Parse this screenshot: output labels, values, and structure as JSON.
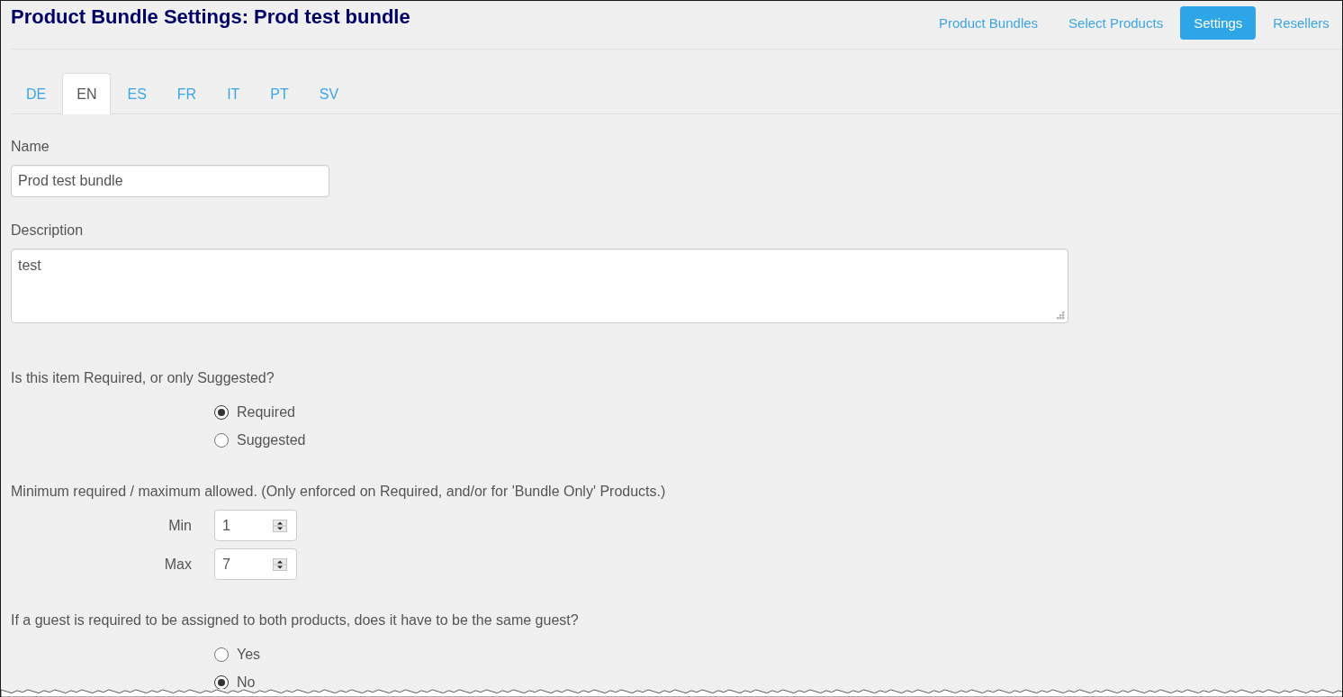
{
  "header": {
    "title": "Product Bundle Settings: Prod test bundle",
    "nav": [
      {
        "label": "Product Bundles",
        "selected": false
      },
      {
        "label": "Select Products",
        "selected": false
      },
      {
        "label": "Settings",
        "selected": true
      },
      {
        "label": "Resellers",
        "selected": false
      }
    ]
  },
  "language_tabs": [
    {
      "label": "DE",
      "selected": false
    },
    {
      "label": "EN",
      "selected": true
    },
    {
      "label": "ES",
      "selected": false
    },
    {
      "label": "FR",
      "selected": false
    },
    {
      "label": "IT",
      "selected": false
    },
    {
      "label": "PT",
      "selected": false
    },
    {
      "label": "SV",
      "selected": false
    }
  ],
  "form": {
    "name": {
      "label": "Name",
      "value": "Prod test bundle"
    },
    "description": {
      "label": "Description",
      "value": "test"
    },
    "requirement": {
      "question": "Is this item Required, or only Suggested?",
      "options": [
        {
          "label": "Required",
          "selected": true
        },
        {
          "label": "Suggested",
          "selected": false
        }
      ]
    },
    "limits": {
      "caption": "Minimum required / maximum allowed. (Only enforced on Required, and/or for 'Bundle Only' Products.)",
      "fields": [
        {
          "label": "Min",
          "value": "1"
        },
        {
          "label": "Max",
          "value": "7"
        }
      ]
    },
    "same_guest": {
      "question": "If a guest is required to be assigned to both products, does it have to be the same guest?",
      "options": [
        {
          "label": "Yes",
          "selected": false
        },
        {
          "label": "No",
          "selected": true
        }
      ]
    }
  }
}
